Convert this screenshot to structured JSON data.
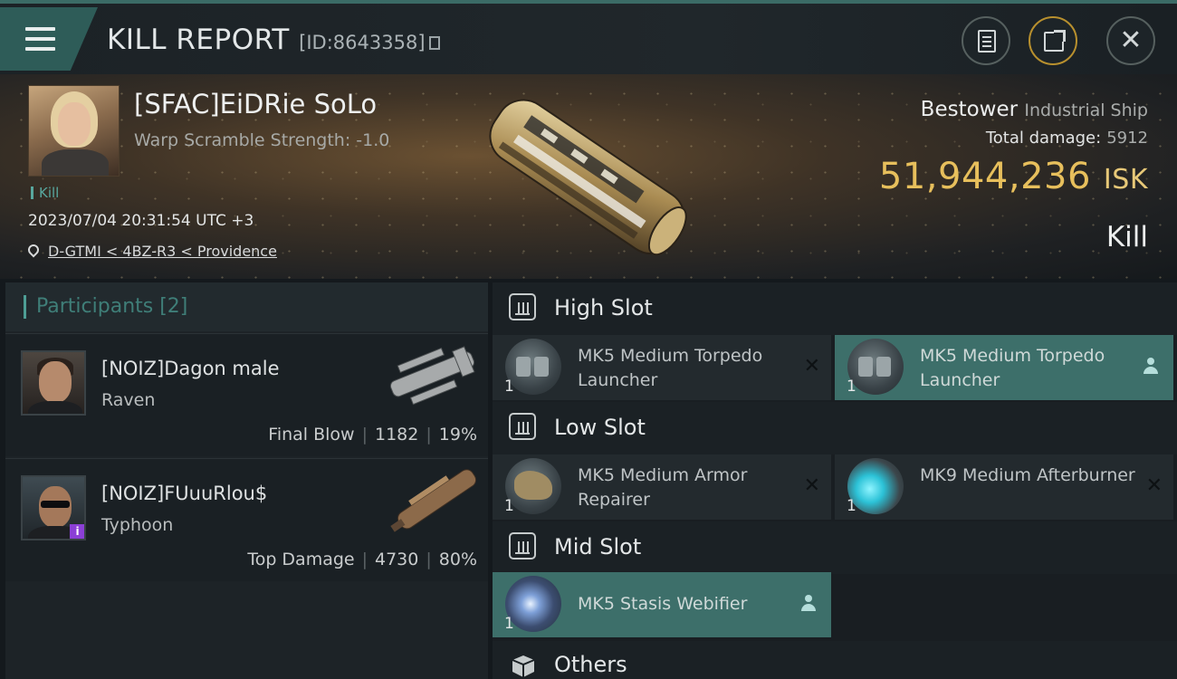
{
  "header": {
    "title": "KILL REPORT",
    "report_id": "[ID:8643358]"
  },
  "victim": {
    "name": "[SFAC]EiDRie SoLo",
    "warp_scramble": "Warp Scramble Strength: -1.0",
    "kill_tag": "Kill",
    "datetime": "2023/07/04 20:31:54 UTC +3",
    "location": "D-GTMI < 4BZ-R3 < Providence",
    "ship_name": "Bestower",
    "ship_class": "Industrial Ship",
    "total_damage_label": "Total damage:",
    "total_damage": "5912",
    "isk_value": "51,944,236",
    "isk_unit": "ISK",
    "result": "Kill"
  },
  "participants": {
    "label": "Participants [2]",
    "rows": [
      {
        "name": "[NOIZ]Dagon male",
        "ship": "Raven",
        "role": "Final Blow",
        "damage": "1182",
        "percent": "19%"
      },
      {
        "name": "[NOIZ]FUuuRlou$",
        "ship": "Typhoon",
        "role": "Top Damage",
        "damage": "4730",
        "percent": "80%",
        "badge": "i"
      }
    ]
  },
  "fitting": {
    "high_slot": {
      "label": "High Slot",
      "modules": [
        {
          "name": "MK5 Medium Torpedo Launcher",
          "qty": "1",
          "status": "destroyed",
          "icon": "torpedo-launcher-icon"
        },
        {
          "name": "MK5 Medium Torpedo Launcher",
          "qty": "1",
          "status": "dropped",
          "icon": "torpedo-launcher-icon"
        }
      ]
    },
    "low_slot": {
      "label": "Low Slot",
      "modules": [
        {
          "name": "MK5 Medium Armor Repairer",
          "qty": "1",
          "status": "destroyed",
          "icon": "armor-repairer-icon"
        },
        {
          "name": "MK9 Medium Afterburner",
          "qty": "1",
          "status": "destroyed",
          "icon": "afterburner-icon"
        }
      ]
    },
    "mid_slot": {
      "label": "Mid Slot",
      "modules": [
        {
          "name": "MK5 Stasis Webifier",
          "qty": "1",
          "status": "dropped",
          "icon": "stasis-webifier-icon"
        }
      ]
    },
    "others": {
      "label": "Others"
    }
  },
  "colors": {
    "accent_teal": "#3d6f6a",
    "isk_gold": "#e7bf5c",
    "badge_purple": "#8b3fd6"
  }
}
